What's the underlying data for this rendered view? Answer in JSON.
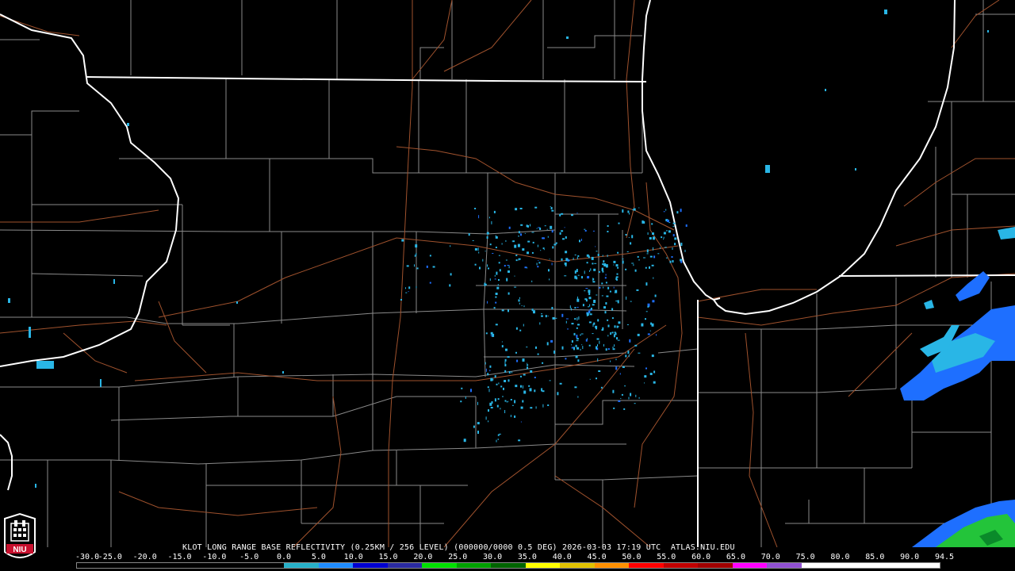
{
  "caption": "KLOT LONG RANGE BASE REFLECTIVITY (0.25KM / 256 LEVEL) (000000/0000 0.5 DEG) 2026-03-03 17:19 UTC  ATLAS.NIU.EDU",
  "logo": {
    "text": "NIU",
    "icon": "niu-seal-icon"
  },
  "scale": {
    "labels": [
      "-30.0",
      "-25.0",
      "-20.0",
      "-15.0",
      "-10.0",
      "-5.0",
      "0.0",
      "5.0",
      "10.0",
      "15.0",
      "20.0",
      "25.0",
      "30.0",
      "35.0",
      "40.0",
      "45.0",
      "50.0",
      "55.0",
      "60.0",
      "65.0",
      "70.0",
      "75.0",
      "80.0",
      "85.0",
      "90.0",
      "94.5"
    ],
    "colors": [
      "#000000",
      "#000000",
      "#000000",
      "#000000",
      "#000000",
      "#000000",
      "#27b0c8",
      "#1f8cff",
      "#0000d0",
      "#2a2aa0",
      "#00e000",
      "#00a000",
      "#006400",
      "#ffff00",
      "#e0c000",
      "#ff9000",
      "#ff0000",
      "#c00000",
      "#a00000",
      "#ff00ff",
      "#9050d0",
      "#ffffff",
      "#ffffff",
      "#ffffff",
      "#ffffff"
    ]
  },
  "map_colors": {
    "background": "#000000",
    "state_border": "#ffffff",
    "county_border": "#8a8a8a",
    "highway": "#a0522d",
    "echo_light": "#29b6e6",
    "echo_medium": "#1e6fff",
    "echo_green": "#23c43a"
  }
}
